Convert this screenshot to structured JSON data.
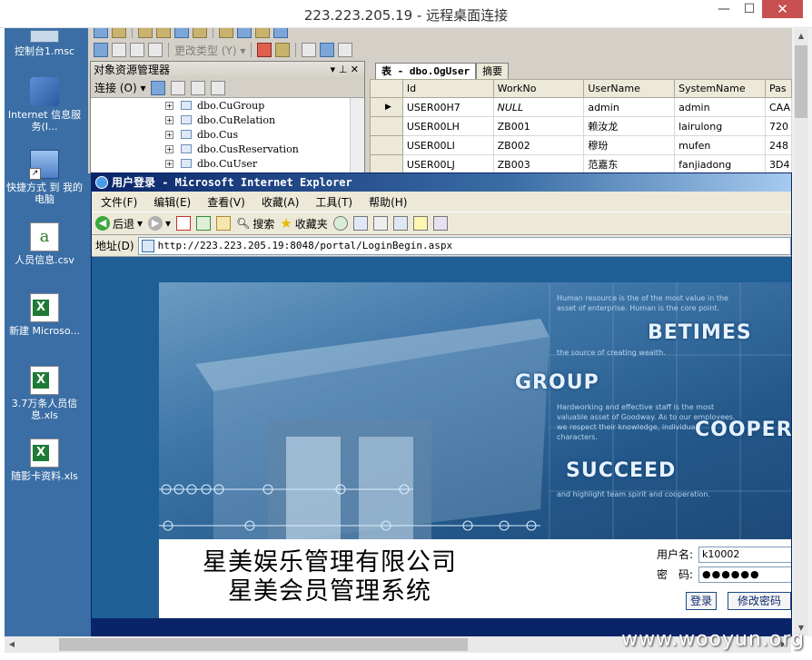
{
  "rdp": {
    "title": "223.223.205.19 - 远程桌面连接",
    "min": "—",
    "max": "☐",
    "close": "✕"
  },
  "desktop": {
    "icons": [
      {
        "label": "控制台1.msc",
        "icon": "msc-icon"
      },
      {
        "label": "Internet 信息服务(I...",
        "icon": "iis-icon"
      },
      {
        "label": "快捷方式 到 我的电脑",
        "icon": "computer-shortcut-icon"
      },
      {
        "label": "人员信息.csv",
        "icon": "csv-file-icon"
      },
      {
        "label": "新建 Microso...",
        "icon": "excel-file-icon"
      },
      {
        "label": "3.7万条人员信息.xls",
        "icon": "excel-file-icon"
      },
      {
        "label": "随影卡资料.xls",
        "icon": "excel-file-icon"
      }
    ]
  },
  "ssms": {
    "toolbar_change_type": "更改类型 (Y) ▾",
    "object_explorer": {
      "title": "对象资源管理器",
      "pin": "▾ ⊥ ✕",
      "connect": "连接 (O) ▾",
      "tree": [
        "dbo.CuGroup",
        "dbo.CuRelation",
        "dbo.Cus",
        "dbo.CusReservation",
        "dbo.CuUser"
      ]
    },
    "tabs": [
      {
        "label": "表 - dbo.OgUser",
        "close": ""
      },
      {
        "label": "摘要"
      }
    ],
    "grid": {
      "columns": [
        "",
        "Id",
        "WorkNo",
        "UserName",
        "SystemName",
        "Pas"
      ],
      "rows": [
        {
          "sel": "▶",
          "Id": "USER00H7",
          "WorkNo": "NULL",
          "UserName": "admin",
          "SystemName": "admin",
          "Pas": "CAA"
        },
        {
          "sel": "",
          "Id": "USER00LH",
          "WorkNo": "ZB001",
          "UserName": "赖汝龙",
          "SystemName": "lairulong",
          "Pas": "720"
        },
        {
          "sel": "",
          "Id": "USER00LI",
          "WorkNo": "ZB002",
          "UserName": "穆玢",
          "SystemName": "mufen",
          "Pas": "248"
        },
        {
          "sel": "",
          "Id": "USER00LJ",
          "WorkNo": "ZB003",
          "UserName": "范嘉东",
          "SystemName": "fanjiadong",
          "Pas": "3D4"
        }
      ]
    }
  },
  "ie": {
    "title": "用户登录 - Microsoft Internet Explorer",
    "menu": [
      "文件(F)",
      "编辑(E)",
      "查看(V)",
      "收藏(A)",
      "工具(T)",
      "帮助(H)"
    ],
    "back": "后退",
    "search": "搜索",
    "favorites": "收藏夹",
    "address_label": "地址(D)",
    "url": "http://223.223.205.19:8048/portal/LoginBegin.aspx"
  },
  "login": {
    "banner": {
      "words": [
        "BETIMES",
        "GROUP",
        "COOPER",
        "SUCCEED"
      ],
      "text1": "Human resource is the of the most value in the asset of enterprise. Human is the core point.",
      "text2": "the source of creating wealth.",
      "text3": "Hardworking and effective staff is the most valuable asset of Goodway. As to our employees, we respect their knowledge, individual characters.",
      "text4": "and highlight team spirit and cooperation."
    },
    "company_line1": "星美娱乐管理有限公司",
    "company_line2": "星美会员管理系统",
    "username_label": "用户名:",
    "username_value": "k10002",
    "password_label": "密　码:",
    "password_value": "●●●●●●",
    "login_button": "登录",
    "change_pwd_button": "修改密码"
  },
  "watermark": "www.wooyun.org"
}
